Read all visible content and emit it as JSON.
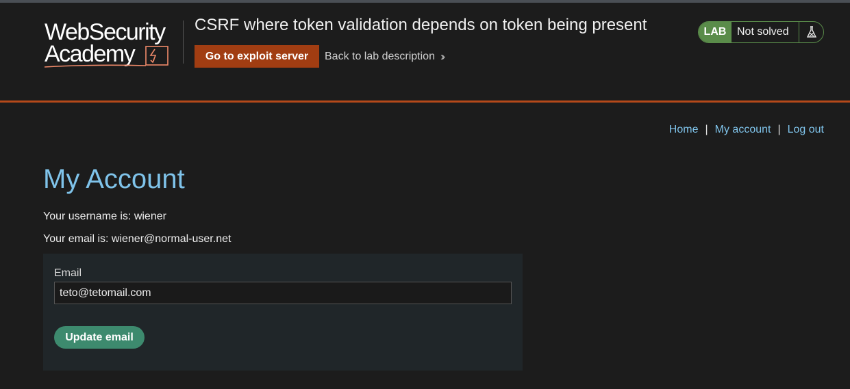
{
  "header": {
    "logo_line1": "WebSecurity",
    "logo_line2": "Academy",
    "lab_title": "CSRF where token validation depends on token being present",
    "exploit_button": "Go to exploit server",
    "back_link": "Back to lab description",
    "status_badge": "LAB",
    "status_text": "Not solved"
  },
  "nav": {
    "home": "Home",
    "sep1": "|",
    "my_account": "My account",
    "sep2": "|",
    "log_out": "Log out"
  },
  "main": {
    "title": "My Account",
    "username_line": "Your username is: wiener",
    "email_line": "Your email is: wiener@normal-user.net"
  },
  "form": {
    "email_label": "Email",
    "email_value": "teto@tetomail.com",
    "submit_label": "Update email"
  },
  "colors": {
    "accent_orange": "#a13d12",
    "link_blue": "#7fc3ea",
    "lab_green": "#5a8c4a",
    "button_green": "#3d8a6e"
  },
  "icons": {
    "back": "double-chevron-right-icon",
    "status": "flask-icon",
    "logo": "web-security-academy-logo"
  }
}
